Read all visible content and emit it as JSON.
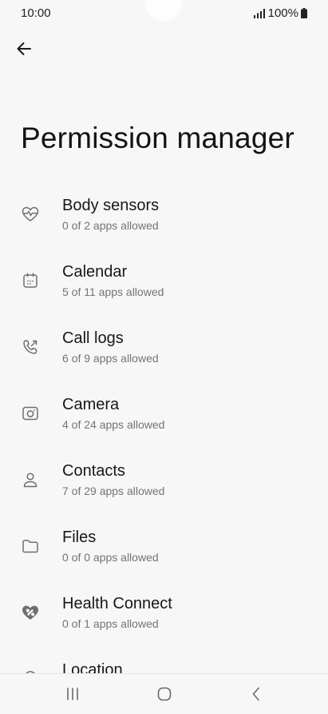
{
  "status_bar": {
    "time": "10:00",
    "battery": "100%",
    "icons": [
      "signal-icon",
      "battery-icon"
    ]
  },
  "header": {
    "back_icon": "arrow-left-icon",
    "title": "Permission manager"
  },
  "permissions": [
    {
      "label": "Body sensors",
      "subtitle": "0 of 2 apps allowed",
      "icon": "heart-pulse-icon"
    },
    {
      "label": "Calendar",
      "subtitle": "5 of 11 apps allowed",
      "icon": "calendar-icon"
    },
    {
      "label": "Call logs",
      "subtitle": "6 of 9 apps allowed",
      "icon": "call-log-icon"
    },
    {
      "label": "Camera",
      "subtitle": "4 of 24 apps allowed",
      "icon": "camera-icon"
    },
    {
      "label": "Contacts",
      "subtitle": "7 of 29 apps allowed",
      "icon": "person-icon"
    },
    {
      "label": "Files",
      "subtitle": "0 of 0 apps allowed",
      "icon": "folder-icon"
    },
    {
      "label": "Health Connect",
      "subtitle": "0 of 1 apps allowed",
      "icon": "health-connect-icon"
    },
    {
      "label": "Location",
      "subtitle": "",
      "icon": "location-icon"
    }
  ],
  "nav_bar": {
    "icons": [
      "recent-apps-icon",
      "home-icon",
      "back-nav-icon"
    ]
  },
  "colors": {
    "background": "#f7f7f7",
    "text_primary": "#171717",
    "text_secondary": "#747474",
    "icon": "#6f6f6f"
  }
}
